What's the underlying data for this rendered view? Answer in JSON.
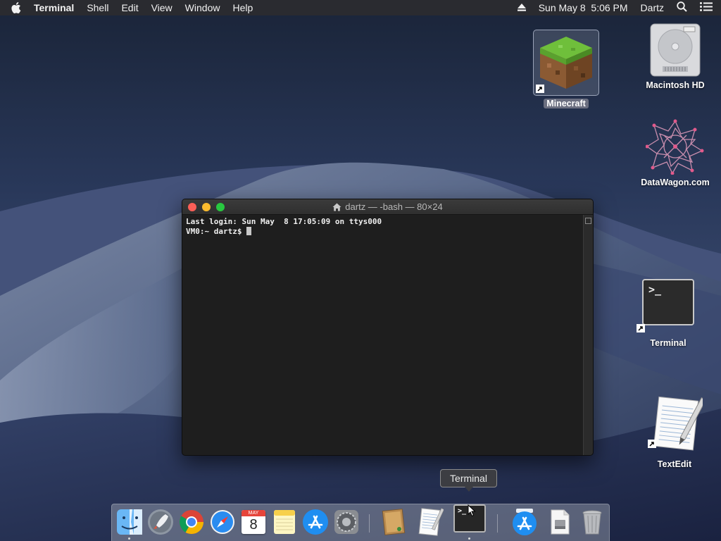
{
  "menubar": {
    "app_name": "Terminal",
    "items": [
      "Shell",
      "Edit",
      "View",
      "Window",
      "Help"
    ],
    "datetime": "Sun May 8  5:06 PM",
    "user": "Dartz"
  },
  "desktop": {
    "icons": [
      {
        "label": "Minecraft",
        "icon": "minecraft-icon",
        "selected": true
      },
      {
        "label": "Macintosh HD",
        "icon": "hard-drive-icon"
      },
      {
        "label": "DataWagon.com",
        "icon": "datawagon-icon"
      },
      {
        "label": "Terminal",
        "icon": "terminal-icon"
      },
      {
        "label": "TextEdit",
        "icon": "textedit-icon"
      }
    ]
  },
  "terminal": {
    "title": "dartz — -bash — 80×24",
    "lines": [
      "Last login: Sun May  8 17:05:09 on ttys000",
      "VM0:~ dartz$ "
    ]
  },
  "tooltip": {
    "text": "Terminal"
  },
  "dock": {
    "items": [
      "finder-icon",
      "launchpad-icon",
      "chrome-icon",
      "safari-icon",
      "calendar-icon",
      "notes-icon",
      "app-store-icon",
      "system-preferences-icon",
      "textedit-folder-icon",
      "textedit-doc-icon",
      "terminal-icon",
      "app-store-downloads-icon",
      "disk-image-icon",
      "trash-icon"
    ],
    "calendar_month": "MAY",
    "calendar_day": "8",
    "terminal_prompt": ">_"
  },
  "colors": {
    "close": "#fc5f57",
    "minimize": "#fdbc2e",
    "maximize": "#28c840",
    "menubar_bg": "#2a2b30",
    "terminal_bg": "#1e1e1e"
  }
}
